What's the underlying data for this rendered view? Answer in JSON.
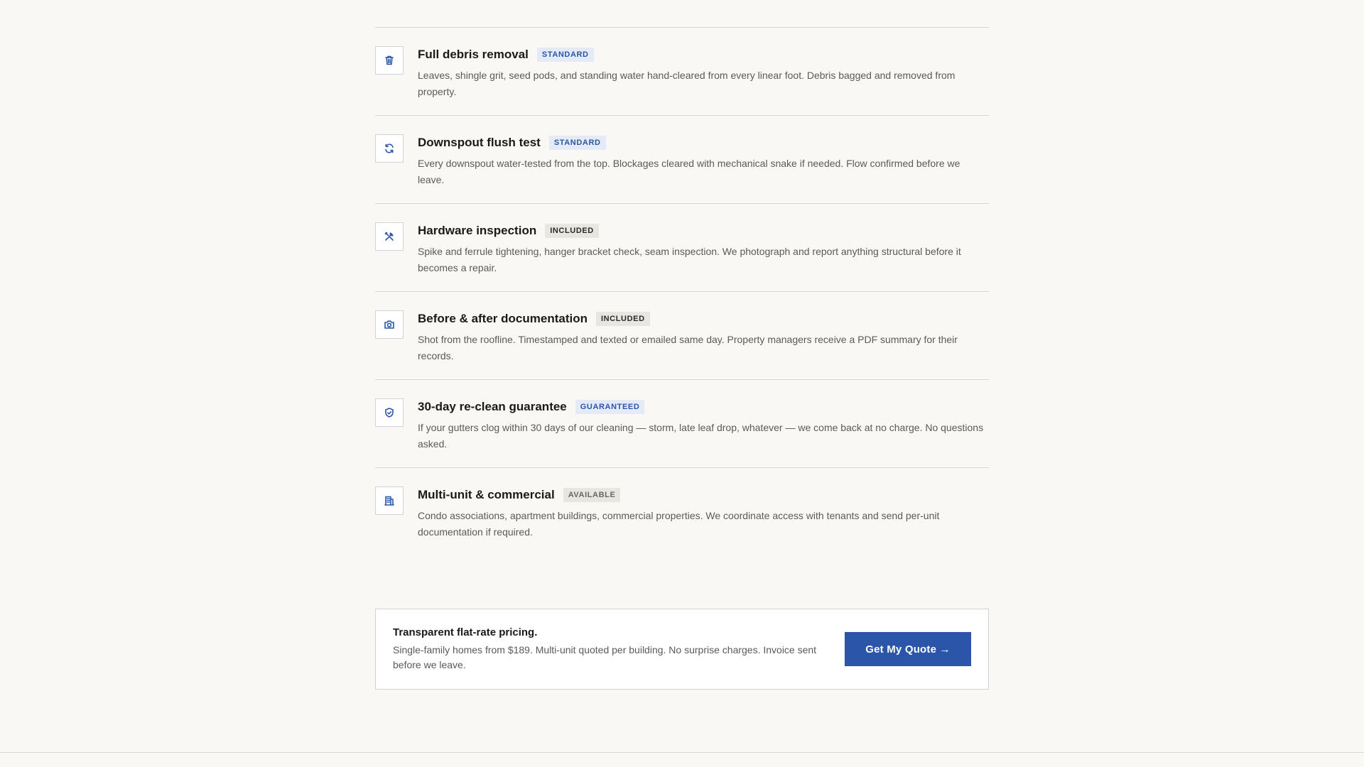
{
  "services": [
    {
      "icon": "trash-icon",
      "title": "Full debris removal",
      "badge": "STANDARD",
      "badge_style": "blue",
      "description": "Leaves, shingle grit, seed pods, and standing water hand-cleared from every linear foot. Debris bagged and removed from property."
    },
    {
      "icon": "refresh-icon",
      "title": "Downspout flush test",
      "badge": "STANDARD",
      "badge_style": "blue",
      "description": "Every downspout water-tested from the top. Blockages cleared with mechanical snake if needed. Flow confirmed before we leave."
    },
    {
      "icon": "tools-icon",
      "title": "Hardware inspection",
      "badge": "INCLUDED",
      "badge_style": "gray",
      "description": "Spike and ferrule tightening, hanger bracket check, seam inspection. We photograph and report anything structural before it becomes a repair."
    },
    {
      "icon": "camera-icon",
      "title": "Before & after documentation",
      "badge": "INCLUDED",
      "badge_style": "gray",
      "description": "Shot from the roofline. Timestamped and texted or emailed same day. Property managers receive a PDF summary for their records."
    },
    {
      "icon": "shield-check-icon",
      "title": "30-day re-clean guarantee",
      "badge": "GUARANTEED",
      "badge_style": "blue",
      "description": "If your gutters clog within 30 days of our cleaning — storm, late leaf drop, whatever — we come back at no charge. No questions asked."
    },
    {
      "icon": "building-icon",
      "title": "Multi-unit & commercial",
      "badge": "AVAILABLE",
      "badge_style": "muted",
      "description": "Condo associations, apartment buildings, commercial properties. We coordinate access with tenants and send per-unit documentation if required."
    }
  ],
  "pricing": {
    "title": "Transparent flat-rate pricing.",
    "description": "Single-family homes from $189. Multi-unit quoted per building. No surprise charges. Invoice sent before we leave.",
    "button_label": "Get My Quote →"
  },
  "colors": {
    "accent": "#2b55a8",
    "background": "#f9f8f5"
  }
}
